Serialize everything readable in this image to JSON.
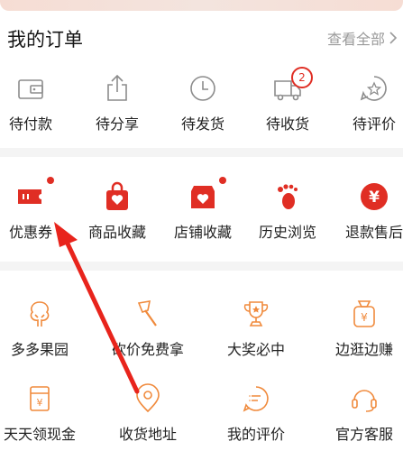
{
  "header": {
    "title": "我的订单",
    "view_all": "查看全部"
  },
  "orders": [
    {
      "label": "待付款",
      "icon": "wallet-icon"
    },
    {
      "label": "待分享",
      "icon": "share-icon"
    },
    {
      "label": "待发货",
      "icon": "clock-icon"
    },
    {
      "label": "待收货",
      "icon": "truck-icon",
      "badge": "2"
    },
    {
      "label": "待评价",
      "icon": "review-icon"
    }
  ],
  "services": [
    {
      "label": "优惠券",
      "icon": "coupon-icon",
      "dot": true
    },
    {
      "label": "商品收藏",
      "icon": "bag-heart-icon"
    },
    {
      "label": "店铺收藏",
      "icon": "store-heart-icon",
      "dot": true
    },
    {
      "label": "历史浏览",
      "icon": "footprint-icon"
    },
    {
      "label": "退款售后",
      "icon": "yen-circle-icon"
    }
  ],
  "tools_row1": [
    {
      "label": "多多果园",
      "icon": "tree-icon"
    },
    {
      "label": "砍价免费拿",
      "icon": "axe-icon"
    },
    {
      "label": "大奖必中",
      "icon": "trophy-icon"
    },
    {
      "label": "边逛边赚",
      "icon": "money-bag-icon"
    }
  ],
  "tools_row2": [
    {
      "label": "天天领现金",
      "icon": "cash-icon"
    },
    {
      "label": "收货地址",
      "icon": "location-icon"
    },
    {
      "label": "我的评价",
      "icon": "comment-icon"
    },
    {
      "label": "官方客服",
      "icon": "headset-icon"
    }
  ],
  "colors": {
    "accent": "#e02e24",
    "icon_gray": "#8c8c8c",
    "tool_orange": "#f08a3c"
  }
}
